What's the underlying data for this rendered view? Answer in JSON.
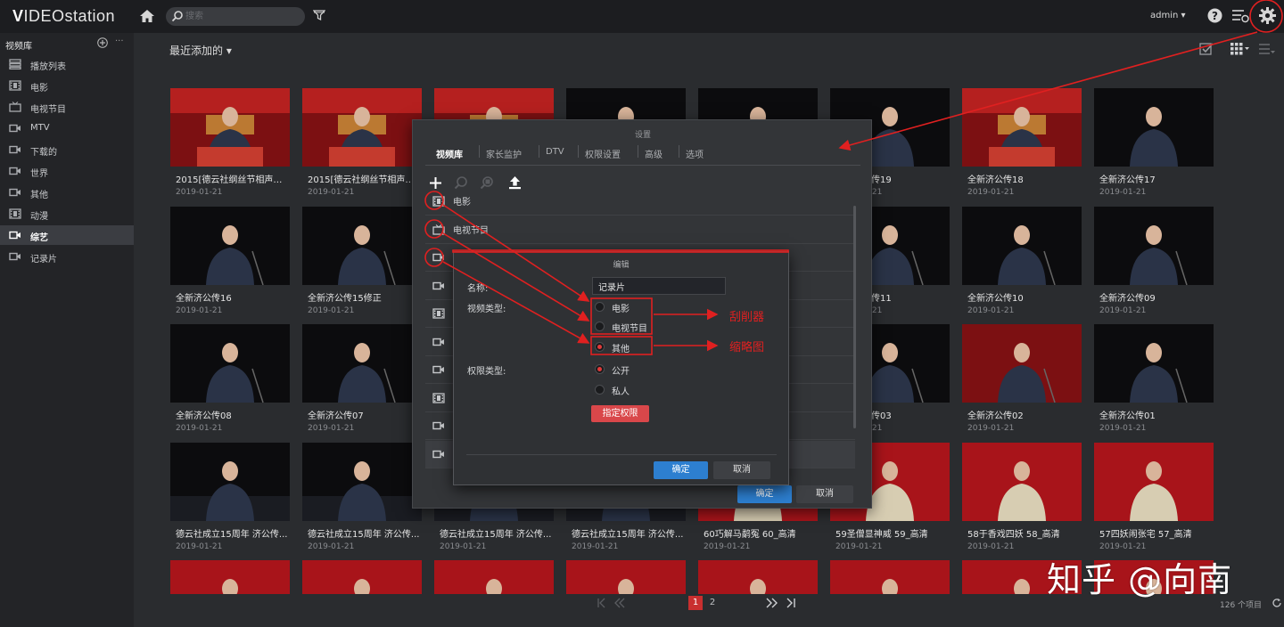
{
  "app": {
    "logo_bold": "V",
    "logo_rest": "IDEOstation",
    "search_placeholder": "搜索",
    "user": "admin ▾"
  },
  "colors": {
    "accent": "#c92f2f",
    "primary_button": "#2d7fd0",
    "annotation": "#e02020"
  },
  "sidebar": {
    "header": "视频库",
    "items": [
      {
        "label": "播放列表",
        "icon": "playlist-icon"
      },
      {
        "label": "电影",
        "icon": "movie-icon"
      },
      {
        "label": "电视节目",
        "icon": "tv-icon"
      },
      {
        "label": "MTV",
        "icon": "video-camera-icon"
      },
      {
        "label": "下载的",
        "icon": "video-camera-icon"
      },
      {
        "label": "世界",
        "icon": "video-camera-icon"
      },
      {
        "label": "其他",
        "icon": "video-camera-icon"
      },
      {
        "label": "动漫",
        "icon": "movie-icon"
      },
      {
        "label": "综艺",
        "icon": "video-camera-icon",
        "active": true
      },
      {
        "label": "记录片",
        "icon": "video-camera-icon"
      }
    ]
  },
  "main": {
    "title": "最近添加的 ▾"
  },
  "videos": [
    {
      "title": "2015[德云社纲丝节相声大...",
      "date": "2019-01-21"
    },
    {
      "title": "2015[德云社纲丝节相声大...",
      "date": "2019-01-21"
    },
    {
      "title": "",
      "date": ""
    },
    {
      "title": "",
      "date": ""
    },
    {
      "title": "",
      "date": ""
    },
    {
      "title": "全新济公传19",
      "date": "2019-01-21"
    },
    {
      "title": "全新济公传18",
      "date": "2019-01-21"
    },
    {
      "title": "全新济公传17",
      "date": "2019-01-21"
    },
    {
      "title": "全新济公传16",
      "date": "2019-01-21"
    },
    {
      "title": "全新济公传15修正",
      "date": "2019-01-21"
    },
    {
      "title": "",
      "date": ""
    },
    {
      "title": "",
      "date": ""
    },
    {
      "title": "",
      "date": ""
    },
    {
      "title": "全新济公传11",
      "date": "2019-01-21"
    },
    {
      "title": "全新济公传10",
      "date": "2019-01-21"
    },
    {
      "title": "全新济公传09",
      "date": "2019-01-21"
    },
    {
      "title": "全新济公传08",
      "date": "2019-01-21"
    },
    {
      "title": "全新济公传07",
      "date": "2019-01-21"
    },
    {
      "title": "",
      "date": ""
    },
    {
      "title": "",
      "date": ""
    },
    {
      "title": "",
      "date": ""
    },
    {
      "title": "全新济公传03",
      "date": "2019-01-21"
    },
    {
      "title": "全新济公传02",
      "date": "2019-01-21"
    },
    {
      "title": "全新济公传01",
      "date": "2019-01-21"
    },
    {
      "title": "德云社成立15周年 济公传...",
      "date": "2019-01-21"
    },
    {
      "title": "德云社成立15周年 济公传...",
      "date": "2019-01-21"
    },
    {
      "title": "德云社成立15周年 济公传...",
      "date": "2019-01-21"
    },
    {
      "title": "德云社成立15周年 济公传...",
      "date": "2019-01-21"
    },
    {
      "title": "60巧解马鹬冤 60_高清",
      "date": "2019-01-21"
    },
    {
      "title": "59圣僧显神威 59_高清",
      "date": "2019-01-21"
    },
    {
      "title": "58于香戏四妖 58_高清",
      "date": "2019-01-21"
    },
    {
      "title": "57四妖闹张宅 57_高清",
      "date": "2019-01-21"
    }
  ],
  "pager": {
    "pages": [
      "1",
      "2"
    ],
    "count": "126 个项目"
  },
  "settings": {
    "title": "设置",
    "tabs": [
      "视频库",
      "家长监护",
      "DTV",
      "权限设置",
      "高级",
      "选项"
    ],
    "rows": [
      {
        "label": "电影",
        "icon": "movie-icon"
      },
      {
        "label": "电视节目",
        "icon": "tv-icon"
      },
      {
        "label": "",
        "icon": "video-camera-icon"
      },
      {
        "label": "",
        "icon": "video-camera-icon"
      },
      {
        "label": "",
        "icon": "movie-icon"
      },
      {
        "label": "",
        "icon": "video-camera-icon"
      },
      {
        "label": "",
        "icon": "video-camera-icon"
      },
      {
        "label": "",
        "icon": "movie-icon"
      },
      {
        "label": "",
        "icon": "video-camera-icon"
      },
      {
        "label": "",
        "icon": "video-camera-icon"
      }
    ],
    "ok": "确定",
    "cancel": "取消"
  },
  "edit": {
    "title": "编辑",
    "name_label": "名称:",
    "name_value": "记录片",
    "type_label": "视频类型:",
    "type_options": [
      {
        "label": "电影",
        "selected": false
      },
      {
        "label": "电视节目",
        "selected": false
      },
      {
        "label": "其他",
        "selected": true
      }
    ],
    "perm_label": "权限类型:",
    "perm_options": [
      {
        "label": "公开",
        "selected": true
      },
      {
        "label": "私人",
        "selected": false
      }
    ],
    "assign_button": "指定权限",
    "ok": "确定",
    "cancel": "取消"
  },
  "annotations": {
    "note_1": "刮削器",
    "note_2": "缩略图"
  },
  "watermark": "知乎 @向南"
}
